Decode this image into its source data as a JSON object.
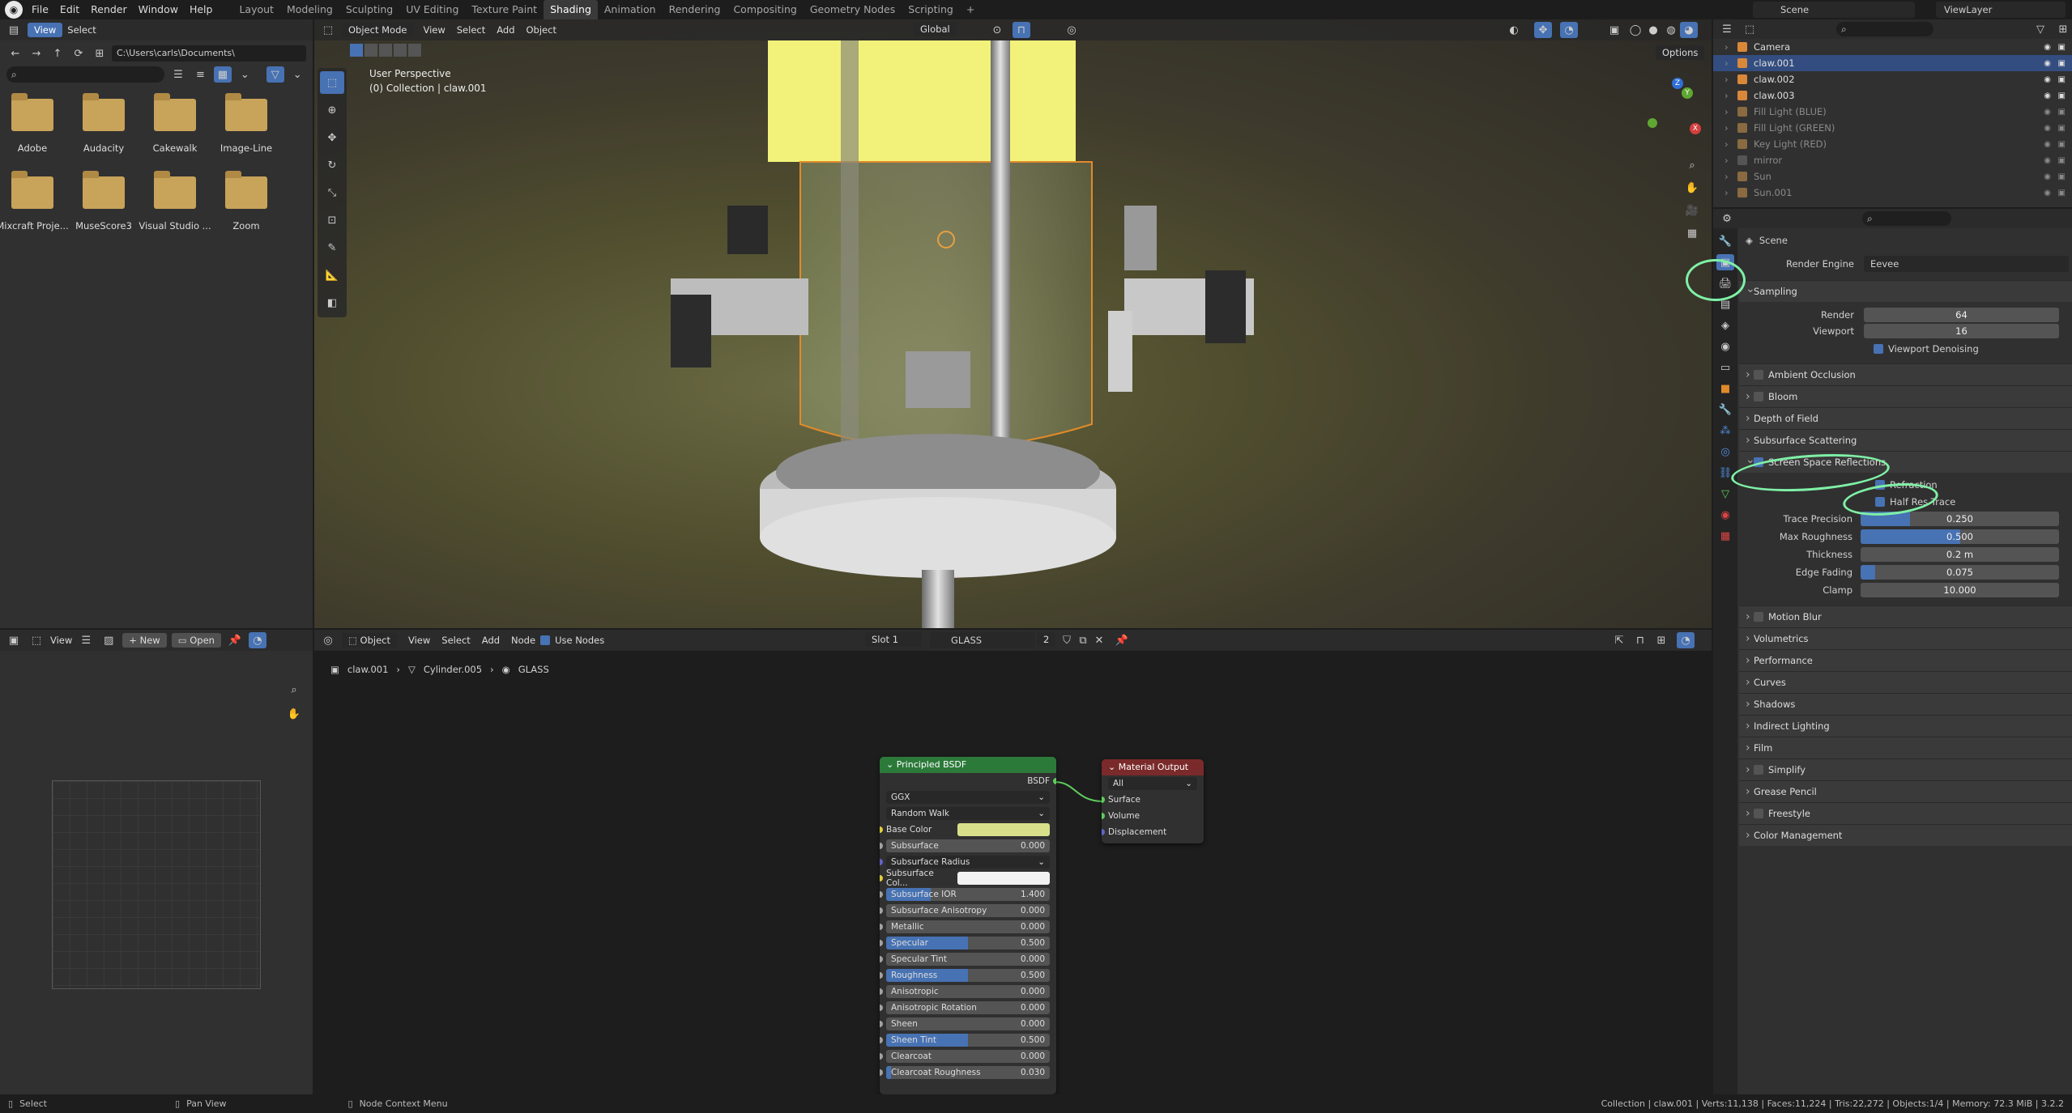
{
  "topbar": {
    "menus": [
      "File",
      "Edit",
      "Render",
      "Window",
      "Help"
    ],
    "workspaces": [
      "Layout",
      "Modeling",
      "Sculpting",
      "UV Editing",
      "Texture Paint",
      "Shading",
      "Animation",
      "Rendering",
      "Compositing",
      "Geometry Nodes",
      "Scripting"
    ],
    "active_workspace": "Shading",
    "add_tab": "+",
    "scene": "Scene",
    "view_layer": "ViewLayer"
  },
  "file_browser": {
    "menu_view": "View",
    "menu_select": "Select",
    "path": "C:\\Users\\carls\\Documents\\",
    "folders": [
      "Adobe",
      "Audacity",
      "Cakewalk",
      "Image-Line",
      "Mixcraft Proje...",
      "MuseScore3",
      "Visual Studio ...",
      "Zoom"
    ]
  },
  "viewport": {
    "mode": "Object Mode",
    "menus": [
      "View",
      "Select",
      "Add",
      "Object"
    ],
    "transform": "Global",
    "options": "Options",
    "overlay_line1": "User Perspective",
    "overlay_line2": "(0) Collection | claw.001",
    "axes": [
      "Z",
      "Y",
      "X"
    ]
  },
  "image_editor": {
    "view": "View",
    "new": "New",
    "open": "Open"
  },
  "node_editor": {
    "object_mode": "Object",
    "menus": [
      "View",
      "Select",
      "Add",
      "Node"
    ],
    "use_nodes": "Use Nodes",
    "slot": "Slot 1",
    "material": "GLASS",
    "users": "2",
    "breadcrumb": [
      "claw.001",
      "Cylinder.005",
      "GLASS"
    ],
    "principled": {
      "title": "Principled BSDF",
      "output": "BSDF",
      "distribution": "GGX",
      "subsurface_method": "Random Walk",
      "base_color_label": "Base Color",
      "base_color": "#d9e08a",
      "subsurface_radius": "Subsurface Radius",
      "subsurface_color_label": "Subsurface Col...",
      "rows": [
        {
          "label": "Subsurface",
          "value": "0.000",
          "fill": 0
        },
        {
          "label": "Subsurface IOR",
          "value": "1.400",
          "fill": 0.27
        },
        {
          "label": "Subsurface Anisotropy",
          "value": "0.000",
          "fill": 0
        },
        {
          "label": "Metallic",
          "value": "0.000",
          "fill": 0
        },
        {
          "label": "Specular",
          "value": "0.500",
          "fill": 0.5
        },
        {
          "label": "Specular Tint",
          "value": "0.000",
          "fill": 0
        },
        {
          "label": "Roughness",
          "value": "0.500",
          "fill": 0.5
        },
        {
          "label": "Anisotropic",
          "value": "0.000",
          "fill": 0
        },
        {
          "label": "Anisotropic Rotation",
          "value": "0.000",
          "fill": 0
        },
        {
          "label": "Sheen",
          "value": "0.000",
          "fill": 0
        },
        {
          "label": "Sheen Tint",
          "value": "0.500",
          "fill": 0.5
        },
        {
          "label": "Clearcoat",
          "value": "0.000",
          "fill": 0
        },
        {
          "label": "Clearcoat Roughness",
          "value": "0.030",
          "fill": 0.03
        }
      ]
    },
    "output_node": {
      "title": "Material Output",
      "target": "All",
      "inputs": [
        "Surface",
        "Volume",
        "Displacement"
      ]
    }
  },
  "outliner": {
    "items": [
      {
        "name": "Camera",
        "color": "#d9883a",
        "selected": false,
        "dim": false
      },
      {
        "name": "claw.001",
        "color": "#d9883a",
        "selected": true,
        "dim": false
      },
      {
        "name": "claw.002",
        "color": "#d9883a",
        "selected": false,
        "dim": false
      },
      {
        "name": "claw.003",
        "color": "#d9883a",
        "selected": false,
        "dim": false
      },
      {
        "name": "Fill Light (BLUE)",
        "color": "#8a6a40",
        "selected": false,
        "dim": true
      },
      {
        "name": "Fill Light (GREEN)",
        "color": "#8a6a40",
        "selected": false,
        "dim": true
      },
      {
        "name": "Key Light (RED)",
        "color": "#8a6a40",
        "selected": false,
        "dim": true
      },
      {
        "name": "mirror",
        "color": "#555555",
        "selected": false,
        "dim": true
      },
      {
        "name": "Sun",
        "color": "#8a6a40",
        "selected": false,
        "dim": true
      },
      {
        "name": "Sun.001",
        "color": "#8a6a40",
        "selected": false,
        "dim": true
      }
    ]
  },
  "properties": {
    "context": "Scene",
    "render_engine_label": "Render Engine",
    "render_engine": "Eevee",
    "sampling": {
      "title": "Sampling",
      "render_label": "Render",
      "render": "64",
      "viewport_label": "Viewport",
      "viewport": "16",
      "denoise": "Viewport Denoising"
    },
    "sections_top": [
      "Ambient Occlusion",
      "Bloom",
      "Depth of Field",
      "Subsurface Scattering"
    ],
    "ssr": {
      "title": "Screen Space Reflections",
      "refraction": "Refraction",
      "half_res": "Half Res Trace",
      "fields": [
        {
          "label": "Trace Precision",
          "value": "0.250",
          "fill": 0.25
        },
        {
          "label": "Max Roughness",
          "value": "0.500",
          "fill": 0.5
        },
        {
          "label": "Thickness",
          "value": "0.2 m",
          "fill": 0
        },
        {
          "label": "Edge Fading",
          "value": "0.075",
          "fill": 0.075
        },
        {
          "label": "Clamp",
          "value": "10.000",
          "fill": 0
        }
      ]
    },
    "sections_bottom": [
      "Motion Blur",
      "Volumetrics",
      "Performance",
      "Curves",
      "Shadows",
      "Indirect Lighting",
      "Film",
      "Simplify",
      "Grease Pencil",
      "Freestyle",
      "Color Management"
    ],
    "checkbox_sections": [
      "Ambient Occlusion",
      "Bloom",
      "Motion Blur",
      "Simplify",
      "Freestyle"
    ]
  },
  "statusbar": {
    "left1": "Select",
    "left2": "Pan View",
    "left3": "Node Context Menu",
    "right": "Collection | claw.001 | Verts:11,138 | Faces:11,224 | Tris:22,272 | Objects:1/4 | Memory: 72.3 MiB | 3.2.2"
  }
}
